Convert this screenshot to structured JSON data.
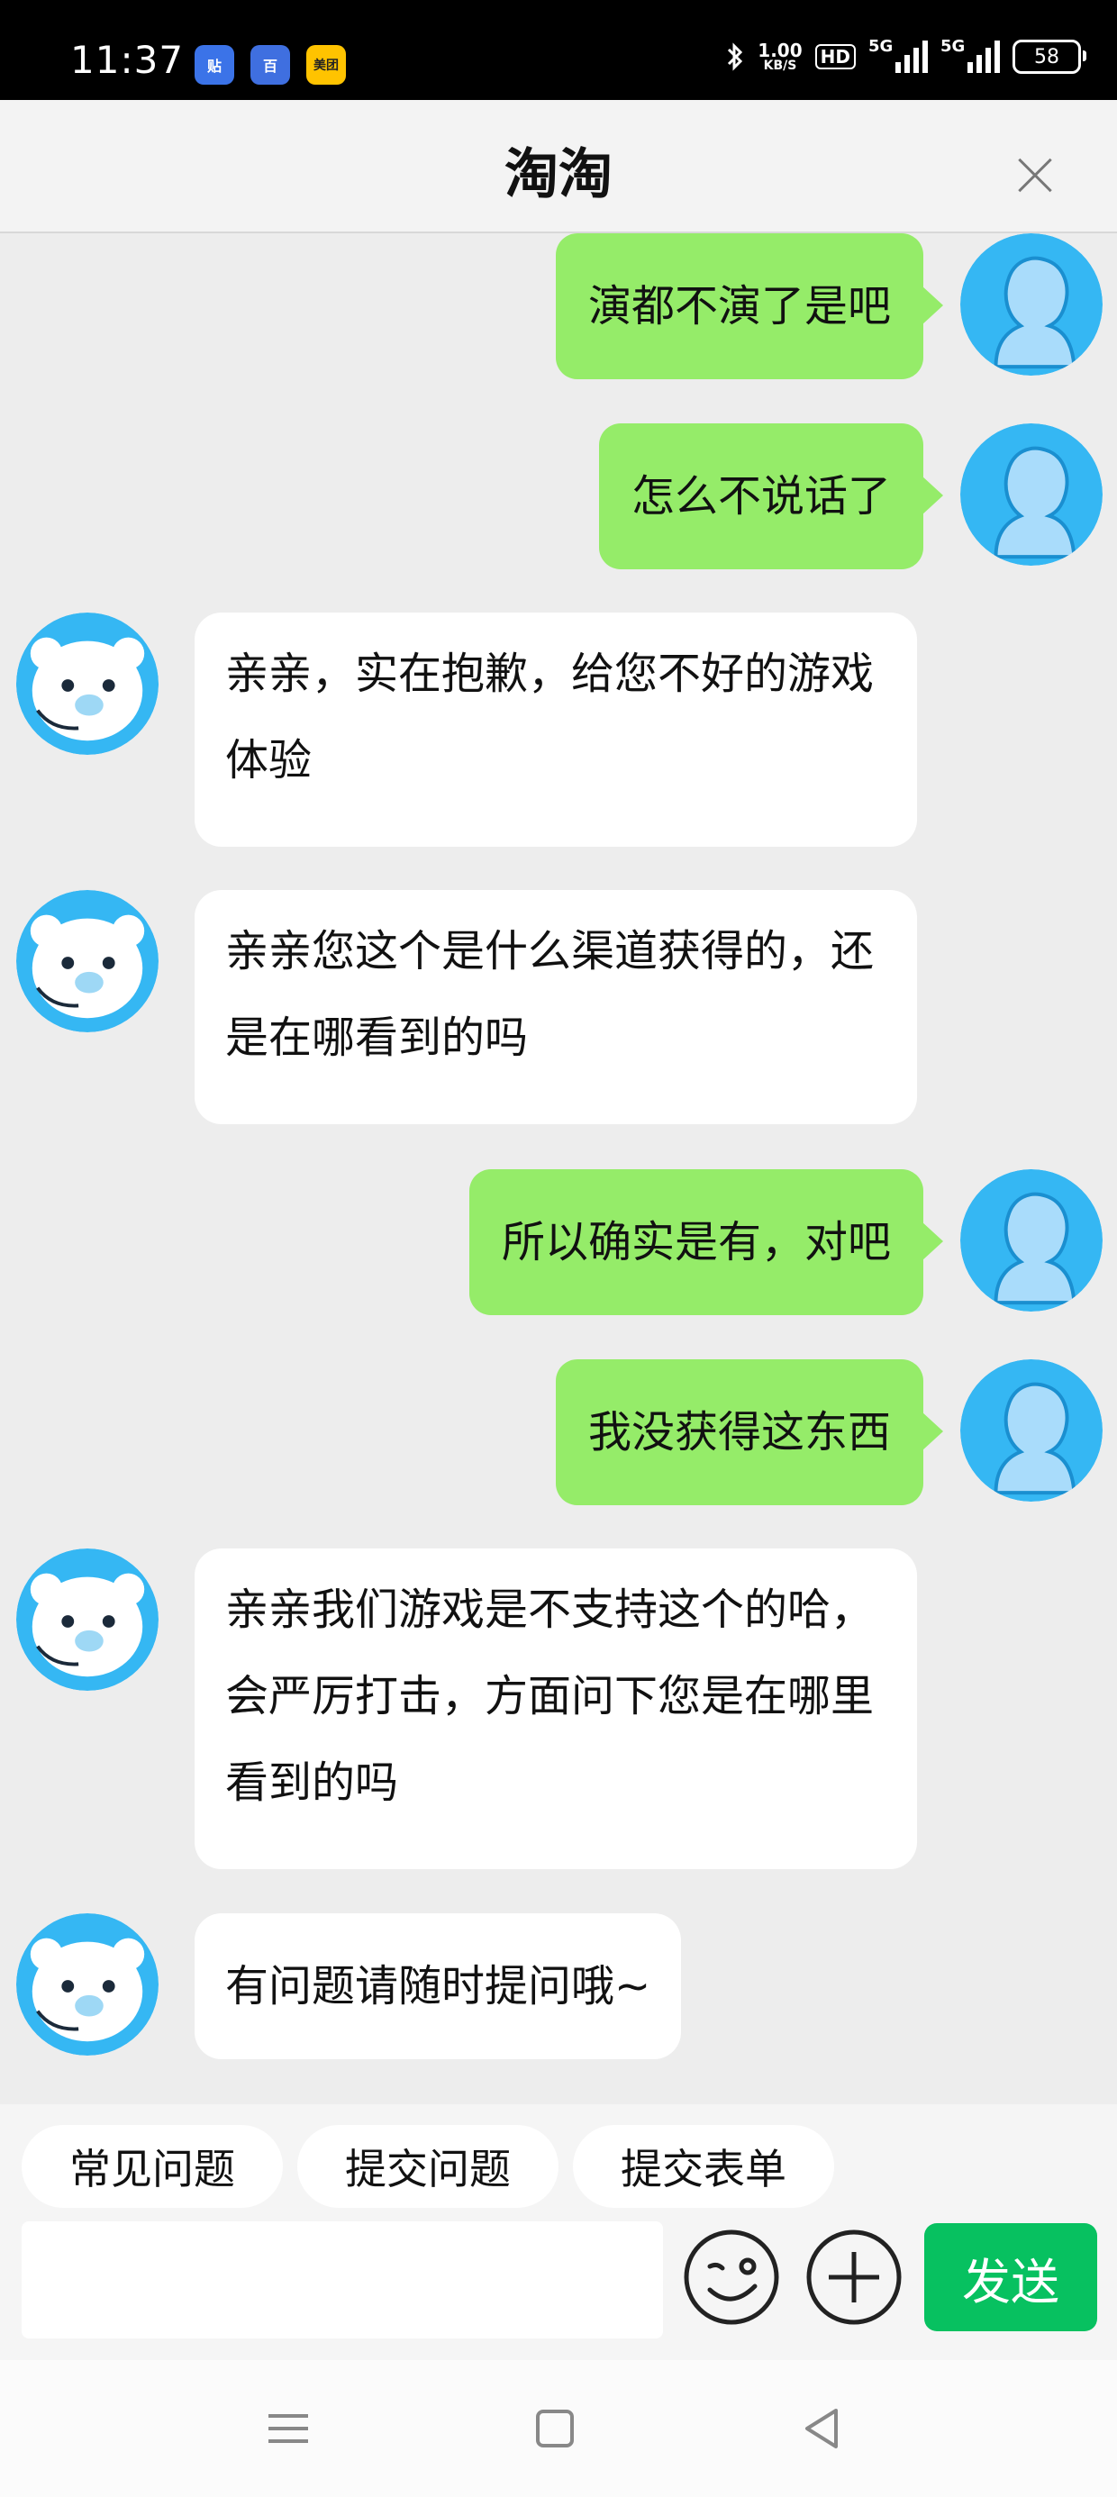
{
  "status_bar": {
    "time": "11:37",
    "badges": [
      "贴",
      "百",
      "美团"
    ],
    "net_speed_value": "1.00",
    "net_speed_unit": "KB/S",
    "hd_label": "HD",
    "signal1_label": "5G",
    "signal2_label": "5G",
    "battery": "58"
  },
  "header": {
    "title": "淘淘"
  },
  "messages": [
    {
      "from": "user",
      "text": "演都不演了是吧"
    },
    {
      "from": "user",
      "text": "怎么不说话了"
    },
    {
      "from": "agent",
      "text": "亲亲，实在抱歉，给您不好的游戏体验"
    },
    {
      "from": "agent",
      "text": "亲亲您这个是什么渠道获得的，还是在哪看到的吗"
    },
    {
      "from": "user",
      "text": "所以确实是有，对吧"
    },
    {
      "from": "user",
      "text": "我没获得这东西"
    },
    {
      "from": "agent",
      "text": "亲亲我们游戏是不支持这个的哈，会严厉打击，方面问下您是在哪里看到的吗"
    },
    {
      "from": "agent",
      "text": "有问题请随时提问哦~"
    }
  ],
  "quick_replies": [
    "常见问题",
    "提交问题",
    "提交表单"
  ],
  "composer": {
    "input_value": "",
    "send_label": "发送",
    "emoji_icon": "emoji-icon",
    "plus_icon": "plus-icon"
  },
  "colors": {
    "user_bubble": "#95ec69",
    "agent_bubble": "#ffffff",
    "send_button": "#07c160",
    "background": "#ededed"
  }
}
